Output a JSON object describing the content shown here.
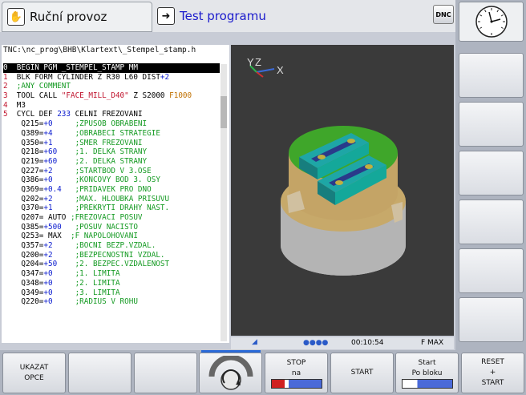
{
  "modes": {
    "manual": "Ruční provoz",
    "test": "Test programu",
    "dnc": "DNC"
  },
  "program": {
    "path": "TNC:\\nc_prog\\BHB\\Klartext\\_Stempel_stamp.h",
    "lines": [
      {
        "n": "0",
        "parts": [
          {
            "t": "  BEGIN PGM _STEMPEL_STAMP MM",
            "c": ""
          }
        ]
      },
      {
        "n": "1",
        "parts": [
          {
            "t": "  BLK FORM CYLINDER Z R30 L60 DIST",
            "c": ""
          },
          {
            "t": "+2",
            "c": "blu"
          }
        ]
      },
      {
        "n": "2",
        "parts": [
          {
            "t": "  ;ANY COMMENT",
            "c": "grn"
          }
        ]
      },
      {
        "n": "3",
        "parts": [
          {
            "t": "  TOOL CALL ",
            "c": ""
          },
          {
            "t": "\"FACE_MILL_D40\"",
            "c": "num"
          },
          {
            "t": " Z S2000 ",
            "c": ""
          },
          {
            "t": "F1000",
            "c": "org"
          }
        ]
      },
      {
        "n": "4",
        "parts": [
          {
            "t": "  M3",
            "c": ""
          }
        ]
      },
      {
        "n": "5",
        "parts": [
          {
            "t": "  CYCL DEF ",
            "c": ""
          },
          {
            "t": "233",
            "c": "blu"
          },
          {
            "t": " CELNI FREZOVANI",
            "c": ""
          }
        ]
      },
      {
        "n": "",
        "parts": [
          {
            "t": "    Q215=",
            "c": ""
          },
          {
            "t": "+0",
            "c": "blu"
          },
          {
            "t": "     ;ZPUSOB OBRABENI",
            "c": "grn"
          }
        ]
      },
      {
        "n": "",
        "parts": [
          {
            "t": "    Q389=",
            "c": ""
          },
          {
            "t": "+4",
            "c": "blu"
          },
          {
            "t": "     ;OBRABECI STRATEGIE",
            "c": "grn"
          }
        ]
      },
      {
        "n": "",
        "parts": [
          {
            "t": "    Q350=",
            "c": ""
          },
          {
            "t": "+1",
            "c": "blu"
          },
          {
            "t": "     ;SMER FREZOVANI",
            "c": "grn"
          }
        ]
      },
      {
        "n": "",
        "parts": [
          {
            "t": "    Q218=",
            "c": ""
          },
          {
            "t": "+60",
            "c": "blu"
          },
          {
            "t": "    ;1. DELKA STRANY",
            "c": "grn"
          }
        ]
      },
      {
        "n": "",
        "parts": [
          {
            "t": "    Q219=",
            "c": ""
          },
          {
            "t": "+60",
            "c": "blu"
          },
          {
            "t": "    ;2. DELKA STRANY",
            "c": "grn"
          }
        ]
      },
      {
        "n": "",
        "parts": [
          {
            "t": "    Q227=",
            "c": ""
          },
          {
            "t": "+2",
            "c": "blu"
          },
          {
            "t": "     ;STARTBOD V 3.OSE",
            "c": "grn"
          }
        ]
      },
      {
        "n": "",
        "parts": [
          {
            "t": "    Q386=",
            "c": ""
          },
          {
            "t": "+0",
            "c": "blu"
          },
          {
            "t": "     ;KONCOVY BOD 3. OSY",
            "c": "grn"
          }
        ]
      },
      {
        "n": "",
        "parts": [
          {
            "t": "    Q369=",
            "c": ""
          },
          {
            "t": "+0.4",
            "c": "blu"
          },
          {
            "t": "   ;PRIDAVEK PRO DNO",
            "c": "grn"
          }
        ]
      },
      {
        "n": "",
        "parts": [
          {
            "t": "    Q202=",
            "c": ""
          },
          {
            "t": "+2",
            "c": "blu"
          },
          {
            "t": "     ;MAX. HLOUBKA PRISUVU",
            "c": "grn"
          }
        ]
      },
      {
        "n": "",
        "parts": [
          {
            "t": "    Q370=",
            "c": ""
          },
          {
            "t": "+1",
            "c": "blu"
          },
          {
            "t": "     ;PREKRYTI DRAHY NAST.",
            "c": "grn"
          }
        ]
      },
      {
        "n": "",
        "parts": [
          {
            "t": "    Q207= AUTO ",
            "c": ""
          },
          {
            "t": ";FREZOVACI POSUV",
            "c": "grn"
          }
        ]
      },
      {
        "n": "",
        "parts": [
          {
            "t": "    Q385=",
            "c": ""
          },
          {
            "t": "+500",
            "c": "blu"
          },
          {
            "t": "   ;POSUV NACISTO",
            "c": "grn"
          }
        ]
      },
      {
        "n": "",
        "parts": [
          {
            "t": "    Q253= MAX  ",
            "c": ""
          },
          {
            "t": ";F NAPOLOHOVANI",
            "c": "grn"
          }
        ]
      },
      {
        "n": "",
        "parts": [
          {
            "t": "    Q357=",
            "c": ""
          },
          {
            "t": "+2",
            "c": "blu"
          },
          {
            "t": "     ;BOCNI BEZP.VZDAL.",
            "c": "grn"
          }
        ]
      },
      {
        "n": "",
        "parts": [
          {
            "t": "    Q200=",
            "c": ""
          },
          {
            "t": "+2",
            "c": "blu"
          },
          {
            "t": "     ;BEZPECNOSTNI VZDAL.",
            "c": "grn"
          }
        ]
      },
      {
        "n": "",
        "parts": [
          {
            "t": "    Q204=",
            "c": ""
          },
          {
            "t": "+50",
            "c": "blu"
          },
          {
            "t": "    ;2. BEZPEC.VZDALENOST",
            "c": "grn"
          }
        ]
      },
      {
        "n": "",
        "parts": [
          {
            "t": "    Q347=",
            "c": ""
          },
          {
            "t": "+0",
            "c": "blu"
          },
          {
            "t": "     ;1. LIMITA",
            "c": "grn"
          }
        ]
      },
      {
        "n": "",
        "parts": [
          {
            "t": "    Q348=",
            "c": ""
          },
          {
            "t": "+0",
            "c": "blu"
          },
          {
            "t": "     ;2. LIMITA",
            "c": "grn"
          }
        ]
      },
      {
        "n": "",
        "parts": [
          {
            "t": "    Q349=",
            "c": ""
          },
          {
            "t": "+0",
            "c": "blu"
          },
          {
            "t": "     ;3. LIMITA",
            "c": "grn"
          }
        ]
      },
      {
        "n": "",
        "parts": [
          {
            "t": "    Q220=",
            "c": ""
          },
          {
            "t": "+0",
            "c": "blu"
          },
          {
            "t": "     ;RADIUS V ROHU",
            "c": "grn"
          }
        ]
      }
    ]
  },
  "graphics": {
    "axis_x": "X",
    "axis_y": "Y",
    "axis_z": "Z"
  },
  "status": {
    "time": "00:10:54",
    "feed": "F MAX"
  },
  "softkeys": {
    "show_options_1": "UKAZAT",
    "show_options_2": "OPCE",
    "stop_1": "STOP",
    "stop_2": "na",
    "start": "START",
    "start_block_1": "Start",
    "start_block_2": "Po bloku",
    "reset_1": "RESET",
    "reset_2": "+",
    "reset_3": "START"
  }
}
